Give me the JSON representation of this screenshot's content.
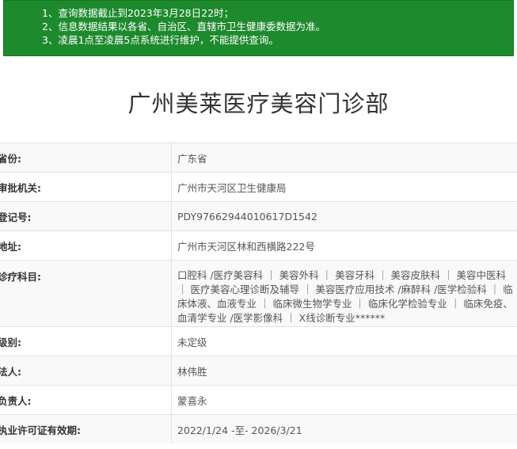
{
  "notice": {
    "lines": [
      "1、查询数据截止到2023年3月28日22时；",
      "2、信息数据结果以各省、自治区、直辖市卫生健康委数据为准。",
      "3、凌晨1点至凌晨5点系统进行维护，不能提供查询。"
    ]
  },
  "page_title": "广州美莱医疗美容门诊部",
  "rows": [
    {
      "label": "省份:",
      "value": "广东省"
    },
    {
      "label": "审批机关:",
      "value": "广州市天河区卫生健康局"
    },
    {
      "label": "登记号:",
      "value": "PDY97662944010617D1542"
    },
    {
      "label": "地址:",
      "value": "广州市天河区林和西横路222号"
    },
    {
      "label": "诊疗科目:",
      "value": "口腔科 /医疗美容科 ｜ 美容外科 ｜ 美容牙科 ｜ 美容皮肤科 ｜ 美容中医科 ｜ 医疗美容心理诊断及辅导 ｜ 美容医疗应用技术 /麻醉科 /医学检验科 ｜ 临床体液、血液专业 ｜ 临床微生物学专业 ｜ 临床化学检验专业 ｜ 临床免疫、血清学专业 /医学影像科 ｜ X线诊断专业******"
    },
    {
      "label": "级别:",
      "value": "未定级"
    },
    {
      "label": "法人:",
      "value": "林伟胜"
    },
    {
      "label": "负责人:",
      "value": "蒙喜永"
    },
    {
      "label": "执业许可证有效期:",
      "value": "2022/1/24 -至- 2026/3/21"
    }
  ]
}
